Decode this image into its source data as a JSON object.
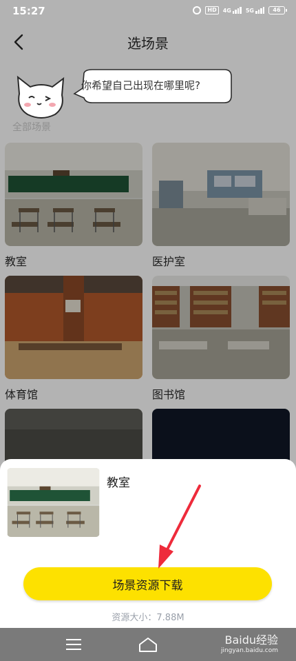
{
  "status_bar": {
    "time": "15:27",
    "hd": "HD",
    "net1": "4G",
    "net2": "5G",
    "battery": "46"
  },
  "header": {
    "title": "选场景",
    "back_icon": "chevron-left-icon"
  },
  "mascot": {
    "speech": "你希望自己出现在哪里呢?"
  },
  "section": {
    "label": "全部场景"
  },
  "scenes": [
    {
      "label": "教室",
      "image": "classroom"
    },
    {
      "label": "医护室",
      "image": "infirmary"
    },
    {
      "label": "体育馆",
      "image": "gymnasium"
    },
    {
      "label": "图书馆",
      "image": "library"
    }
  ],
  "sheet": {
    "title": "教室",
    "download_label": "场景资源下载",
    "size_text": "资源大小：7.88M"
  },
  "watermark": {
    "text": "Baidu经验",
    "sub": "jingyan.baidu.com"
  },
  "colors": {
    "accent": "#fde100",
    "arrow": "#ee2b3b",
    "overlay": "#b3b3b3"
  }
}
